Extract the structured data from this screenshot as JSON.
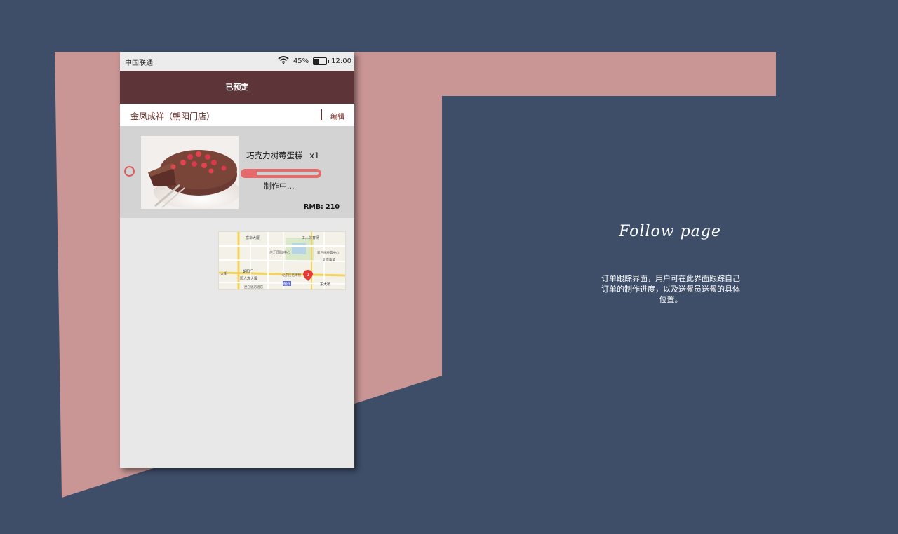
{
  "status_bar": {
    "carrier": "中国联通",
    "battery_percent": "45%",
    "time": "12:00",
    "battery_level": 0.45,
    "icons": [
      "wifi-icon",
      "battery-icon"
    ]
  },
  "nav": {
    "title": "已预定"
  },
  "store": {
    "name": "金凤成祥（朝阳门店）",
    "edit_label": "编辑"
  },
  "order": {
    "product_name": "巧克力树莓蛋糕",
    "quantity": "x1",
    "status": "制作中...",
    "progress": 0.18,
    "price": "RMB: 210"
  },
  "map": {
    "labels": [
      "富华大厦",
      "工人体育场",
      "佳汇国际中心",
      "新世纪经典中心",
      "北京康美",
      "大街",
      "朝阳门",
      "国人寿大厦",
      "北京民俗博物",
      "昆仑饭店酒店",
      "朝外",
      "东大桥"
    ],
    "marker": "1"
  },
  "side_panel": {
    "title": "Follow  page",
    "description": "订单跟踪界面，用户可在此界面跟踪自己订单的制作进度，以及送餐员送餐的具体位置。"
  },
  "colors": {
    "background": "#3e4e69",
    "accent_shape": "#c99595",
    "nav_bar": "#5d3437",
    "progress": "#e46a6c",
    "store_text": "#6b2e2a"
  }
}
